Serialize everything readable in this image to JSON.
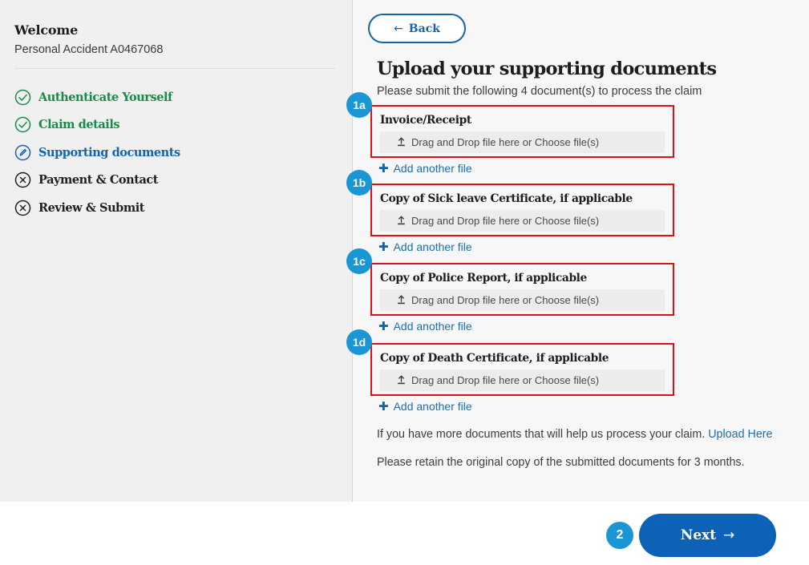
{
  "sidebar": {
    "welcome_title": "Welcome",
    "policy_line": "Personal Accident A0467068",
    "steps": [
      {
        "label": "Authenticate Yourself",
        "state": "done",
        "icon": "check-circle-icon"
      },
      {
        "label": "Claim details",
        "state": "done",
        "icon": "check-circle-icon"
      },
      {
        "label": "Supporting documents",
        "state": "current",
        "icon": "pencil-circle-icon"
      },
      {
        "label": "Payment & Contact",
        "state": "todo",
        "icon": "x-circle-icon"
      },
      {
        "label": "Review & Submit",
        "state": "todo",
        "icon": "x-circle-icon"
      }
    ]
  },
  "content": {
    "back_label": "Back",
    "back_arrow": "←",
    "heading": "Upload your supporting documents",
    "subheading": "Please submit the following 4 document(s) to process the claim",
    "dropzone_label": "Drag and Drop file here or Choose file(s)",
    "add_file_label": "Add another file",
    "plus_glyph": "✚",
    "documents": [
      {
        "badge": "1a",
        "title": "Invoice/Receipt"
      },
      {
        "badge": "1b",
        "title": "Copy of Sick leave Certificate, if applicable"
      },
      {
        "badge": "1c",
        "title": "Copy of Police Report, if applicable"
      },
      {
        "badge": "1d",
        "title": "Copy of Death Certificate, if applicable"
      }
    ],
    "note_more_documents": "If you have more documents that will help us process your claim.",
    "note_more_documents_link": "Upload Here",
    "note_retain": "Please retain the original copy of the submitted documents for 3 months."
  },
  "footer": {
    "next_label": "Next",
    "next_arrow": "→",
    "next_badge": "2"
  },
  "colors": {
    "brand_blue": "#0d62b8",
    "link_blue": "#1a6fb5",
    "badge_blue": "#1b96d4",
    "highlight_red": "#d81217",
    "done_green": "#1a8a4a",
    "sidebar_bg": "#f0f0f0",
    "content_bg": "#f7f7f7"
  }
}
